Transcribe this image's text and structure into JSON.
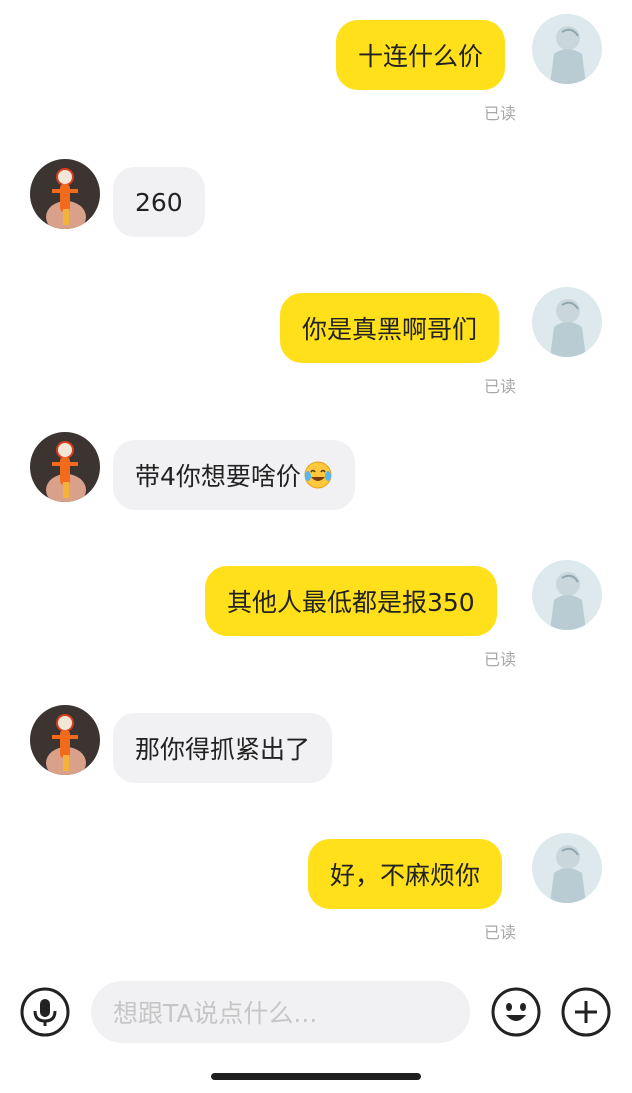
{
  "chat": {
    "messages": [
      {
        "sender": "self",
        "text": "十连什么价",
        "status": "已读"
      },
      {
        "sender": "other",
        "text": "260"
      },
      {
        "sender": "self",
        "text": "你是真黑啊哥们",
        "status": "已读"
      },
      {
        "sender": "other",
        "text": "带4你想要啥价",
        "emoji": "crying-laughing-emoji"
      },
      {
        "sender": "self",
        "text": "其他人最低都是报350",
        "status": "已读"
      },
      {
        "sender": "other",
        "text": "那你得抓紧出了"
      },
      {
        "sender": "self",
        "text": "好，不麻烦你",
        "status": "已读"
      }
    ]
  },
  "input_bar": {
    "placeholder": "想跟TA说点什么...",
    "voice_icon": "microphone-icon",
    "emoji_icon": "smiley-icon",
    "add_icon": "plus-icon"
  },
  "colors": {
    "self_bubble": "#ffe01b",
    "other_bubble": "#f1f1f3",
    "read_status": "#a8a8a8"
  }
}
